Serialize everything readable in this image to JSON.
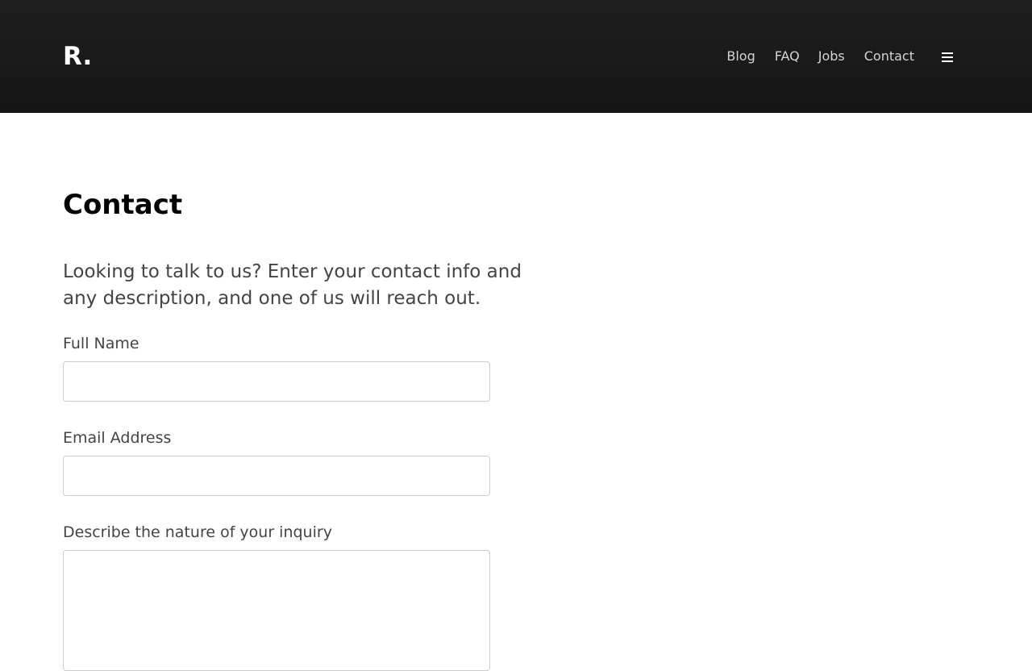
{
  "header": {
    "logo": "R.",
    "nav": {
      "blog": "Blog",
      "faq": "FAQ",
      "jobs": "Jobs",
      "contact": "Contact"
    },
    "menu_icon": "hamburger-menu-icon"
  },
  "main": {
    "title": "Contact",
    "intro": "Looking to talk to us? Enter your contact info and any description, and one of us will reach out.",
    "form": {
      "full_name_label": "Full Name",
      "full_name_value": "",
      "email_label": "Email Address",
      "email_value": "",
      "inquiry_label": "Describe the nature of your inquiry",
      "inquiry_value": ""
    }
  },
  "colors": {
    "header_bg": "#1b1b1b",
    "nav_text": "#d4d4d4",
    "heading": "#000000",
    "body_text": "#444444",
    "input_border": "#cccccc"
  }
}
